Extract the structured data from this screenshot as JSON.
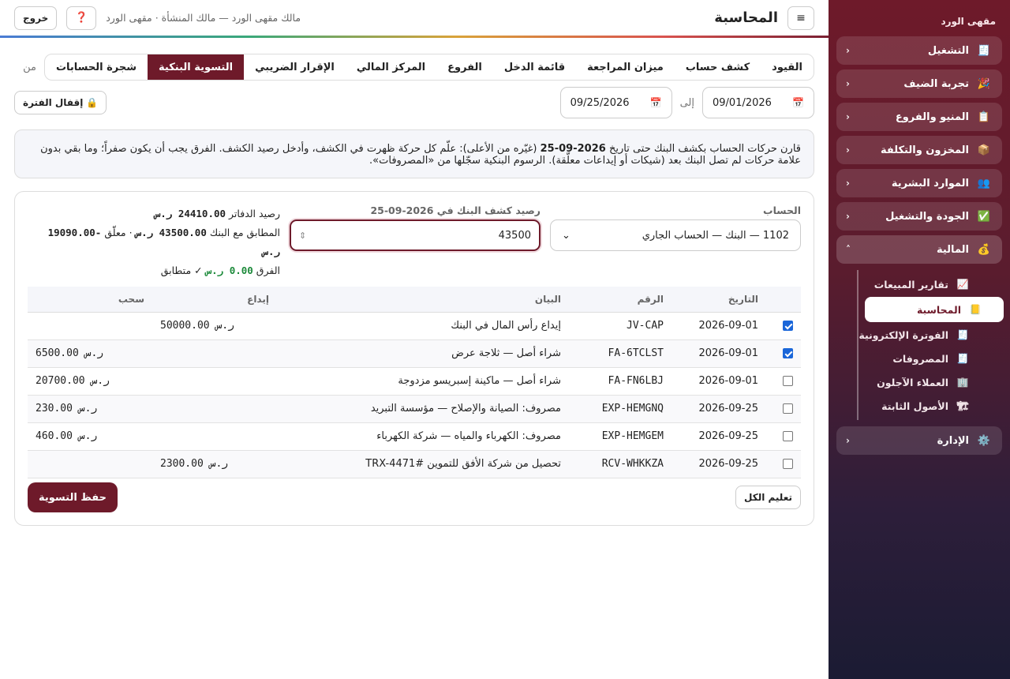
{
  "sidebar": {
    "brand": "مقهى الورد",
    "groups": [
      {
        "label": "التشغيل",
        "icon": "🧾",
        "chevron": "‹"
      },
      {
        "label": "تجربة الضيف",
        "icon": "🎉",
        "chevron": "‹"
      },
      {
        "label": "المنيو والفروع",
        "icon": "📋",
        "chevron": "‹"
      },
      {
        "label": "المخزون والتكلفة",
        "icon": "📦",
        "chevron": "‹"
      },
      {
        "label": "الموارد البشرية",
        "icon": "👥",
        "chevron": "‹"
      },
      {
        "label": "الجودة والتشغيل",
        "icon": "✅",
        "chevron": "‹"
      },
      {
        "label": "المالية",
        "icon": "💰",
        "chevron": "˄"
      },
      {
        "label": "الإدارة",
        "icon": "⚙️",
        "chevron": "‹"
      }
    ],
    "finance_items": [
      {
        "label": "تقارير المبيعات",
        "icon": "📈"
      },
      {
        "label": "المحاسبة",
        "icon": "📒"
      },
      {
        "label": "الفوترة الإلكترونية",
        "icon": "🧾"
      },
      {
        "label": "المصروفات",
        "icon": "🧾"
      },
      {
        "label": "العملاء الآجلون",
        "icon": "🏢"
      },
      {
        "label": "الأصول الثابتة",
        "icon": "🏗"
      }
    ]
  },
  "header": {
    "menu_icon": "≡",
    "title": "المحاسبة",
    "user_info": "مالك مقهى الورد — مالك المنشأة · مقهى الورد",
    "help_icon": "❓",
    "logout": "خروج"
  },
  "tabs": [
    "القيود",
    "كشف حساب",
    "ميزان المراجعة",
    "قائمة الدخل",
    "الفروع",
    "المركز المالي",
    "الإقرار الضريبي",
    "التسوية البنكية",
    "شجرة الحسابات"
  ],
  "active_tab": "التسوية البنكية",
  "filters": {
    "from_label": "من",
    "from_date": "09/01/2026",
    "to_label": "إلى",
    "to_date": "09/25/2026",
    "calendar_icon": "📅",
    "lock_icon": "🔒",
    "close_period": "إقفال الفترة"
  },
  "info": {
    "part1": "قارن حركات الحساب بكشف البنك حتى تاريخ ",
    "date": "2026-09-25",
    "part2": " (غيّره من الأعلى): علّم كل حركة ظهرت في الكشف، وأدخل رصيد الكشف. الفرق يجب أن يكون صفراً؛ وما بقي بدون علامة حركات لم تصل البنك بعد (شيكات أو إيداعات معلّقة). الرسوم البنكية سجّلها من «المصروفات»."
  },
  "form": {
    "account_label": "الحساب",
    "account_value": "1102 — البنك — الحساب الجاري",
    "balance_label": "رصيد كشف البنك في 2026-09-25",
    "balance_value": "43500",
    "summary": {
      "book_label": "رصيد الدفاتر",
      "book_value": "24410.00 ر.س",
      "matched_label": "المطابق مع البنك",
      "matched_value": "43500.00 ر.س",
      "pending_label": "· معلّق",
      "pending_value": "-19090.00 ر.س",
      "diff_label": "الفرق",
      "diff_value": "0.00 ر.س",
      "status": "✓ متطابق"
    }
  },
  "table": {
    "headers": {
      "date": "التاريخ",
      "ref": "الرقم",
      "desc": "البيان",
      "deposit": "إيداع",
      "withdraw": "سحب"
    },
    "rows": [
      {
        "checked": true,
        "date": "2026-09-01",
        "ref": "JV-CAP",
        "desc": "إيداع رأس المال في البنك",
        "deposit": "50000.00 ر.س",
        "withdraw": ""
      },
      {
        "checked": true,
        "date": "2026-09-01",
        "ref": "FA-6TCLST",
        "desc": "شراء أصل — ثلاجة عرض",
        "deposit": "",
        "withdraw": "6500.00 ر.س"
      },
      {
        "checked": false,
        "date": "2026-09-01",
        "ref": "FA-FN6LBJ",
        "desc": "شراء أصل — ماكينة إسبريسو مزدوجة",
        "deposit": "",
        "withdraw": "20700.00 ر.س"
      },
      {
        "checked": false,
        "date": "2026-09-25",
        "ref": "EXP-HEMGNQ",
        "desc": "مصروف: الصيانة والإصلاح — مؤسسة التبريد",
        "deposit": "",
        "withdraw": "230.00 ر.س"
      },
      {
        "checked": false,
        "date": "2026-09-25",
        "ref": "EXP-HEMGEM",
        "desc": "مصروف: الكهرباء والمياه — شركة الكهرباء",
        "deposit": "",
        "withdraw": "460.00 ر.س"
      },
      {
        "checked": false,
        "date": "2026-09-25",
        "ref": "RCV-WHKKZA",
        "desc": "تحصيل من شركة الأفق للتموين #TRX-4471",
        "deposit": "2300.00 ر.س",
        "withdraw": ""
      }
    ]
  },
  "actions": {
    "mark_all": "تعليم الكل",
    "save": "حفظ التسوية"
  }
}
